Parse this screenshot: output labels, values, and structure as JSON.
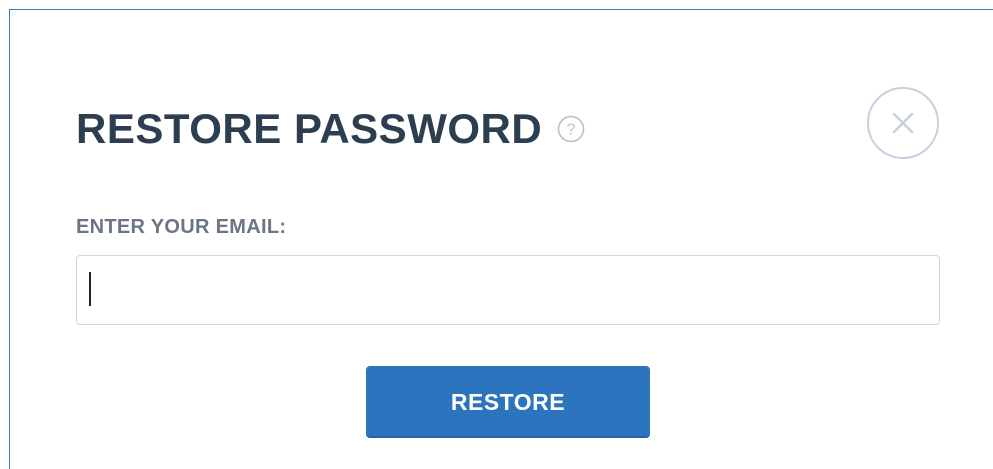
{
  "dialog": {
    "title": "RESTORE PASSWORD",
    "help_icon": "question-circle-icon",
    "close_icon": "close-x-icon"
  },
  "form": {
    "email_label": "ENTER YOUR EMAIL:",
    "email_value": "",
    "email_placeholder": ""
  },
  "actions": {
    "restore_label": "RESTORE"
  },
  "colors": {
    "frame_border": "#2f7fce",
    "title": "#2c3e50",
    "label": "#6b7682",
    "button": "#2d74bf",
    "close_ring": "#c4d2df"
  }
}
